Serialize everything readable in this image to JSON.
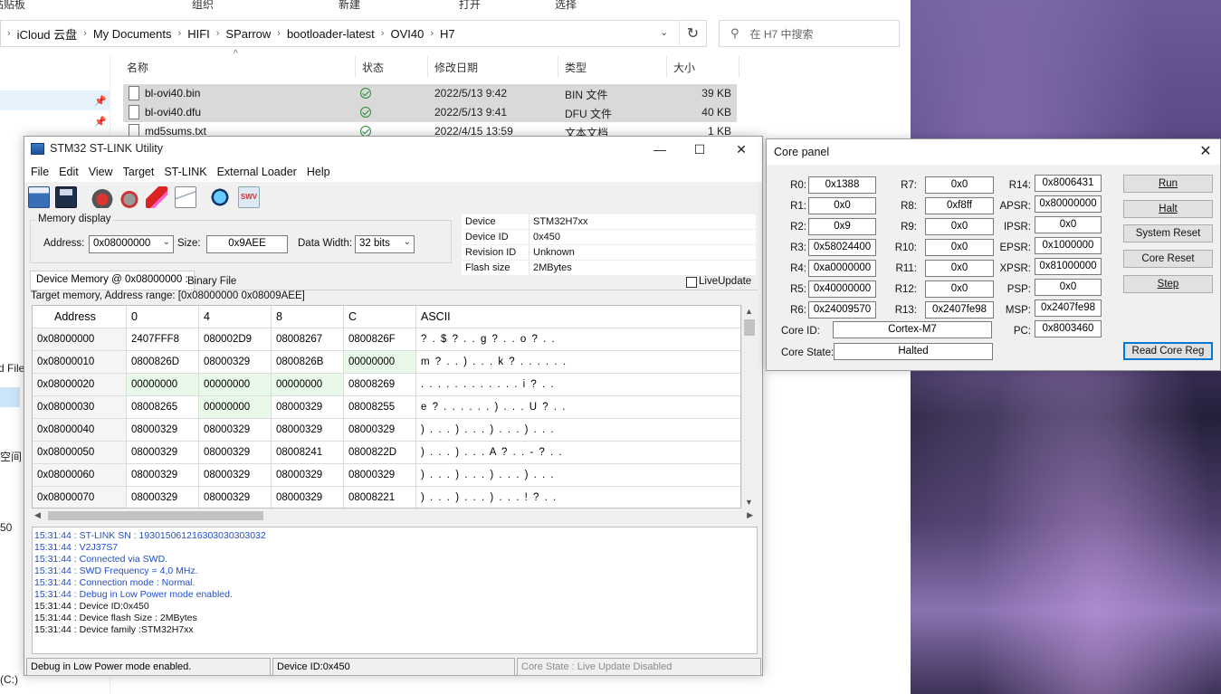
{
  "explorer": {
    "ribbon": [
      "粘贴板",
      "组织",
      "新建",
      "打开",
      "选择"
    ],
    "breadcrumbs": [
      "iCloud 云盘",
      "My Documents",
      "HIFI",
      "SParrow",
      "bootloader-latest",
      "OVI40",
      "H7"
    ],
    "search_placeholder": "在 H7 中搜索",
    "columns": [
      "名称",
      "状态",
      "修改日期",
      "类型",
      "大小"
    ],
    "files": [
      {
        "name": "bl-ovi40.bin",
        "date": "2022/5/13 9:42",
        "type": "BIN 文件",
        "size": "39 KB"
      },
      {
        "name": "bl-ovi40.dfu",
        "date": "2022/5/13 9:41",
        "type": "DFU 文件",
        "size": "40 KB"
      },
      {
        "name": "md5sums.txt",
        "date": "2022/4/15 13:59",
        "type": "文本文档",
        "size": "1 KB"
      }
    ],
    "nav_fragments": [
      "d File",
      "空间",
      "50",
      "(C:)"
    ]
  },
  "stlink": {
    "title": "STM32 ST-LINK Utility",
    "menu": [
      "File",
      "Edit",
      "View",
      "Target",
      "ST-LINK",
      "External Loader",
      "Help"
    ],
    "toolbar_icons": [
      "open-file-icon",
      "save-icon",
      "connect-icon",
      "disconnect-icon",
      "erase-icon",
      "program-verify-icon",
      "full-chip-erase-icon",
      "swv-icon"
    ],
    "swv_label": "SWV",
    "memory_display": {
      "legend": "Memory display",
      "address_label": "Address:",
      "address_value": "0x08000000",
      "size_label": "Size:",
      "size_value": "0x9AEE",
      "width_label": "Data Width:",
      "width_value": "32 bits"
    },
    "device_info": [
      {
        "k": "Device",
        "v": "STM32H7xx"
      },
      {
        "k": "Device ID",
        "v": "0x450"
      },
      {
        "k": "Revision ID",
        "v": "Unknown"
      },
      {
        "k": "Flash size",
        "v": "2MBytes"
      }
    ],
    "tabs": [
      "Device Memory @ 0x08000000 :",
      "Binary File"
    ],
    "live_update": "LiveUpdate",
    "range_text": "Target memory, Address range: [0x08000000 0x08009AEE]",
    "mem_header": [
      "Address",
      "0",
      "4",
      "8",
      "C",
      "ASCII"
    ],
    "mem_rows": [
      [
        "0x08000000",
        "2407FFF8",
        "080002D9",
        "08008267",
        "0800826F",
        "?  . $ ? . . g ? . . o ? . ."
      ],
      [
        "0x08000010",
        "0800826D",
        "08000329",
        "0800826B",
        "00000000",
        "m ? . . ) . . . k ? . . . . . ."
      ],
      [
        "0x08000020",
        "00000000",
        "00000000",
        "00000000",
        "08008269",
        ". . . . . . . . . . . . i ? . ."
      ],
      [
        "0x08000030",
        "08008265",
        "00000000",
        "08000329",
        "08008255",
        "e ? . . . . . . ) . . . U ? . ."
      ],
      [
        "0x08000040",
        "08000329",
        "08000329",
        "08000329",
        "08000329",
        ") . . . ) . . . ) . . . ) . . ."
      ],
      [
        "0x08000050",
        "08000329",
        "08000329",
        "08008241",
        "0800822D",
        ") . . . ) . . . A ? . . - ? . ."
      ],
      [
        "0x08000060",
        "08000329",
        "08000329",
        "08000329",
        "08000329",
        ") . . . ) . . . ) . . . ) . . ."
      ],
      [
        "0x08000070",
        "08000329",
        "08000329",
        "08000329",
        "08008221",
        ") . . . ) . . . ) . . . ! ? . ."
      ]
    ],
    "log": [
      {
        "t": "15:31:44 : ST-LINK SN : 193015061216303030303032",
        "c": "blue"
      },
      {
        "t": "15:31:44 : V2J37S7",
        "c": "blue"
      },
      {
        "t": "15:31:44 : Connected via SWD.",
        "c": "blue"
      },
      {
        "t": "15:31:44 : SWD Frequency = 4,0 MHz.",
        "c": "blue"
      },
      {
        "t": "15:31:44 : Connection mode : Normal.",
        "c": "blue"
      },
      {
        "t": "15:31:44 : Debug in Low Power mode enabled.",
        "c": "blue"
      },
      {
        "t": "15:31:44 : Device ID:0x450",
        "c": "black"
      },
      {
        "t": "15:31:44 : Device flash Size : 2MBytes",
        "c": "black"
      },
      {
        "t": "15:31:44 : Device family :STM32H7xx",
        "c": "black"
      }
    ],
    "status": [
      "Debug in Low Power mode enabled.",
      "Device ID:0x450",
      "Core State : Live Update Disabled"
    ]
  },
  "core_panel": {
    "title": "Core panel",
    "regs_col1": [
      {
        "l": "R0:",
        "v": "0x1388"
      },
      {
        "l": "R1:",
        "v": "0x0"
      },
      {
        "l": "R2:",
        "v": "0x9"
      },
      {
        "l": "R3:",
        "v": "0x58024400"
      },
      {
        "l": "R4:",
        "v": "0xa0000000"
      },
      {
        "l": "R5:",
        "v": "0x40000000"
      },
      {
        "l": "R6:",
        "v": "0x24009570"
      }
    ],
    "regs_col2": [
      {
        "l": "R7:",
        "v": "0x0"
      },
      {
        "l": "R8:",
        "v": "0xf8ff"
      },
      {
        "l": "R9:",
        "v": "0x0"
      },
      {
        "l": "R10:",
        "v": "0x0"
      },
      {
        "l": "R11:",
        "v": "0x0"
      },
      {
        "l": "R12:",
        "v": "0x0"
      },
      {
        "l": "R13:",
        "v": "0x2407fe98"
      }
    ],
    "regs_col3": [
      {
        "l": "R14:",
        "v": "0x8006431"
      },
      {
        "l": "APSR:",
        "v": "0x80000000"
      },
      {
        "l": "IPSR:",
        "v": "0x0"
      },
      {
        "l": "EPSR:",
        "v": "0x1000000"
      },
      {
        "l": "XPSR:",
        "v": "0x81000000"
      },
      {
        "l": "PSP:",
        "v": "0x0"
      },
      {
        "l": "MSP:",
        "v": "0x2407fe98"
      },
      {
        "l": "PC:",
        "v": "0x8003460"
      }
    ],
    "core_id_label": "Core ID:",
    "core_id": "Cortex-M7",
    "core_state_label": "Core State:",
    "core_state": "Halted",
    "buttons": [
      "Run",
      "Halt",
      "System Reset",
      "Core Reset",
      "Step",
      "Read Core Reg"
    ]
  }
}
